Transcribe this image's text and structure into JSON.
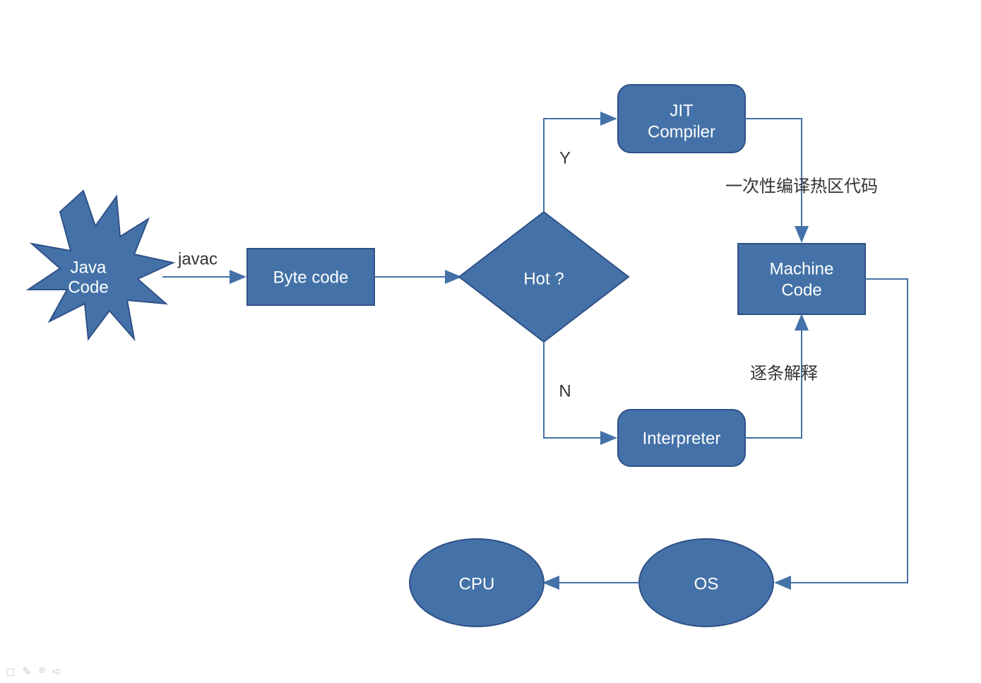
{
  "nodes": {
    "java_code": {
      "line1": "Java",
      "line2": "Code"
    },
    "byte_code": "Byte code",
    "hot": "Hot ?",
    "jit": {
      "line1": "JIT",
      "line2": "Compiler"
    },
    "interpreter": "Interpreter",
    "machine_code": {
      "line1": "Machine",
      "line2": "Code"
    },
    "os": "OS",
    "cpu": "CPU"
  },
  "labels": {
    "javac": "javac",
    "y": "Y",
    "n": "N",
    "compile_all": "一次性编译热区代码",
    "interpret_each": "逐条解释"
  },
  "colors": {
    "fill": "#4472A8",
    "stroke": "#2F5187",
    "connector": "#4472A8"
  }
}
